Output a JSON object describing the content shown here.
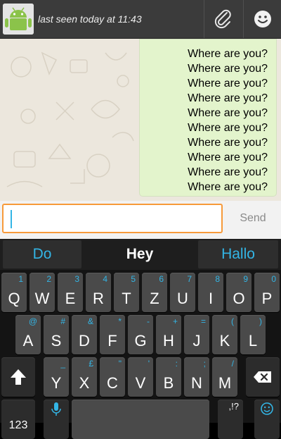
{
  "header": {
    "last_seen": "last seen today at 11:43"
  },
  "chat": {
    "messages": [
      "Where are you?",
      "Where are you?",
      "Where are you?",
      "Where are you?",
      "Where are you?",
      "Where are you?",
      "Where are you?",
      "Where are you?",
      "Where are you?",
      "Where are you?"
    ]
  },
  "input": {
    "value": "",
    "send_label": "Send"
  },
  "keyboard": {
    "suggestions": [
      "Do",
      "Hey",
      "Hallo"
    ],
    "row1": [
      {
        "main": "Q",
        "hint": "1"
      },
      {
        "main": "W",
        "hint": "2"
      },
      {
        "main": "E",
        "hint": "3"
      },
      {
        "main": "R",
        "hint": "4"
      },
      {
        "main": "T",
        "hint": "5"
      },
      {
        "main": "Z",
        "hint": "6"
      },
      {
        "main": "U",
        "hint": "7"
      },
      {
        "main": "I",
        "hint": "8"
      },
      {
        "main": "O",
        "hint": "9"
      },
      {
        "main": "P",
        "hint": "0"
      }
    ],
    "row2": [
      {
        "main": "A",
        "hint": "@"
      },
      {
        "main": "S",
        "hint": "#"
      },
      {
        "main": "D",
        "hint": "&"
      },
      {
        "main": "F",
        "hint": "*"
      },
      {
        "main": "G",
        "hint": "-"
      },
      {
        "main": "H",
        "hint": "+"
      },
      {
        "main": "J",
        "hint": "="
      },
      {
        "main": "K",
        "hint": "("
      },
      {
        "main": "L",
        "hint": ")"
      }
    ],
    "row3": [
      {
        "main": "Y",
        "hint": "_"
      },
      {
        "main": "X",
        "hint": "£"
      },
      {
        "main": "C",
        "hint": "\""
      },
      {
        "main": "V",
        "hint": "'"
      },
      {
        "main": "B",
        "hint": ":"
      },
      {
        "main": "N",
        "hint": ";"
      },
      {
        "main": "M",
        "hint": "/"
      }
    ],
    "bottom": {
      "num_label": "123",
      "punct_label": ",!?"
    }
  },
  "colors": {
    "accent": "#33b5e5",
    "input_border": "#f79a3a",
    "bubble": "#e3f4cc"
  }
}
